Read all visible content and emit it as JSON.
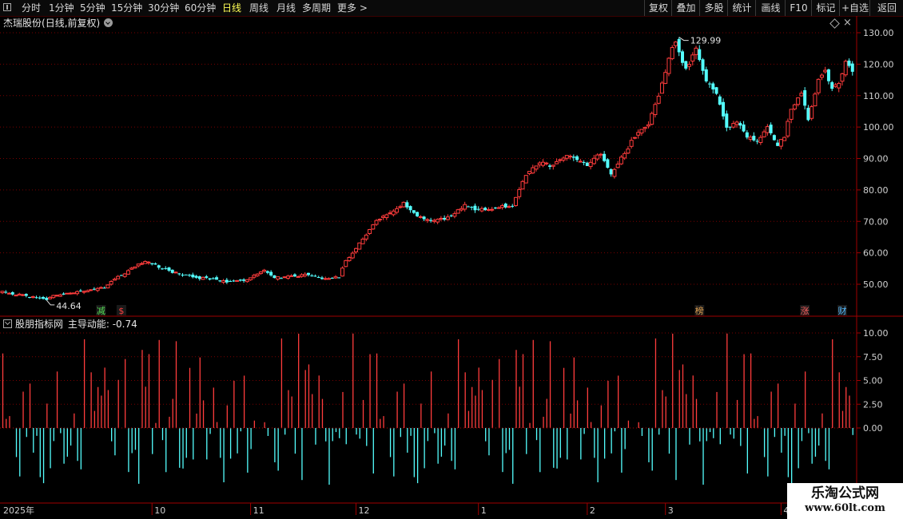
{
  "toolbar": {
    "periods": [
      "分时",
      "1分钟",
      "5分钟",
      "15分钟",
      "30分钟",
      "60分钟",
      "日线",
      "周线",
      "月线",
      "多周期",
      "更多"
    ],
    "active": "日线",
    "right_buttons": [
      "复权",
      "叠加",
      "多股",
      "统计",
      "画线",
      "F10",
      "标记",
      "+自选",
      "返回"
    ]
  },
  "main_panel": {
    "title": "杰瑞股份",
    "subtitle": "(日线,前复权)"
  },
  "sub_panel": {
    "indicator_source": "股朋指标网",
    "indicator_label": "主导动能:",
    "indicator_value": "-0.74"
  },
  "watermark": {
    "title": "乐淘公式网",
    "url": "www.60lt.com"
  },
  "colors": {
    "up": "#ff3c3c",
    "down": "#54ffff",
    "grid": "#7a0000",
    "axis": "#a00000",
    "tick": "#d0d0d0"
  },
  "chart_data": [
    {
      "type": "candlestick",
      "ylim": [
        41,
        134
      ],
      "yticks": [
        50,
        60,
        70,
        80,
        90,
        100,
        110,
        120,
        130
      ],
      "ytick_labels": [
        "50.00",
        "60.00",
        "70.00",
        "80.00",
        "90.00",
        "100.00",
        "110.00",
        "120.00",
        "130.00"
      ],
      "max_label": "129.99",
      "min_label": "44.64",
      "x_start_label": "2025年",
      "x_months": [
        {
          "label": "10",
          "index": 44
        },
        {
          "label": "11",
          "index": 73
        },
        {
          "label": "12",
          "index": 104
        },
        {
          "label": "1",
          "index": 140
        },
        {
          "label": "2",
          "index": 172
        },
        {
          "label": "3",
          "index": 195
        },
        {
          "label": "4",
          "index": 229
        }
      ],
      "markers": [
        {
          "index": 29,
          "text": "减",
          "color": "#55dd55"
        },
        {
          "index": 35,
          "text": "$",
          "color": "#ff4040"
        },
        {
          "index": 205,
          "text": "榜",
          "color": "#e0a050"
        },
        {
          "index": 236,
          "text": "涨",
          "color": "#ff6060"
        },
        {
          "index": 247,
          "text": "财",
          "color": "#55bbff"
        }
      ],
      "series": [
        {
          "x": [
            0,
            250
          ],
          "close": [
            47.0,
            121.0
          ]
        }
      ],
      "keypoints": [
        [
          0,
          47.5
        ],
        [
          10,
          45.8
        ],
        [
          13,
          45.2
        ],
        [
          15,
          46.5
        ],
        [
          20,
          47.3
        ],
        [
          30,
          49.0
        ],
        [
          33,
          51.5
        ],
        [
          38,
          55.0
        ],
        [
          42,
          57.5
        ],
        [
          47,
          55.0
        ],
        [
          52,
          53.2
        ],
        [
          58,
          52.0
        ],
        [
          62,
          51.5
        ],
        [
          66,
          50.8
        ],
        [
          72,
          51.5
        ],
        [
          77,
          54.5
        ],
        [
          80,
          52.0
        ],
        [
          85,
          52.5
        ],
        [
          90,
          53.0
        ],
        [
          94,
          52.0
        ],
        [
          99,
          52.2
        ],
        [
          101,
          57.5
        ],
        [
          103,
          60.0
        ],
        [
          107,
          66.0
        ],
        [
          110,
          70.0
        ],
        [
          116,
          74.0
        ],
        [
          118,
          76.0
        ],
        [
          122,
          71.5
        ],
        [
          126,
          70.5
        ],
        [
          131,
          71.0
        ],
        [
          136,
          75.0
        ],
        [
          140,
          73.5
        ],
        [
          146,
          74.5
        ],
        [
          150,
          75.0
        ],
        [
          152,
          80.0
        ],
        [
          154,
          85.0
        ],
        [
          158,
          89.0
        ],
        [
          162,
          87.5
        ],
        [
          166,
          91.5
        ],
        [
          172,
          88.0
        ],
        [
          176,
          91.5
        ],
        [
          179,
          85.0
        ],
        [
          182,
          90.0
        ],
        [
          186,
          97.0
        ],
        [
          190,
          101.0
        ],
        [
          193,
          110.0
        ],
        [
          196,
          122.0
        ],
        [
          198,
          127.5
        ],
        [
          201,
          118.0
        ],
        [
          204,
          124.5
        ],
        [
          207,
          115.0
        ],
        [
          210,
          111.0
        ],
        [
          213,
          100.0
        ],
        [
          216,
          101.5
        ],
        [
          219,
          97.0
        ],
        [
          222,
          95.0
        ],
        [
          225,
          100.5
        ],
        [
          228,
          94.0
        ],
        [
          230,
          97.0
        ],
        [
          232,
          106.0
        ],
        [
          235,
          111.0
        ],
        [
          237,
          102.0
        ],
        [
          240,
          115.0
        ],
        [
          242,
          118.0
        ],
        [
          244,
          112.5
        ],
        [
          246,
          114.0
        ],
        [
          248,
          121.0
        ],
        [
          250,
          117.5
        ]
      ]
    },
    {
      "type": "bar",
      "ylim": [
        -6.5,
        11.5
      ],
      "yticks": [
        0,
        2.5,
        5,
        7.5,
        10
      ],
      "ytick_labels": [
        "0.00",
        "2.50",
        "5.00",
        "7.50",
        "10.00"
      ],
      "last_value": -0.74
    }
  ]
}
